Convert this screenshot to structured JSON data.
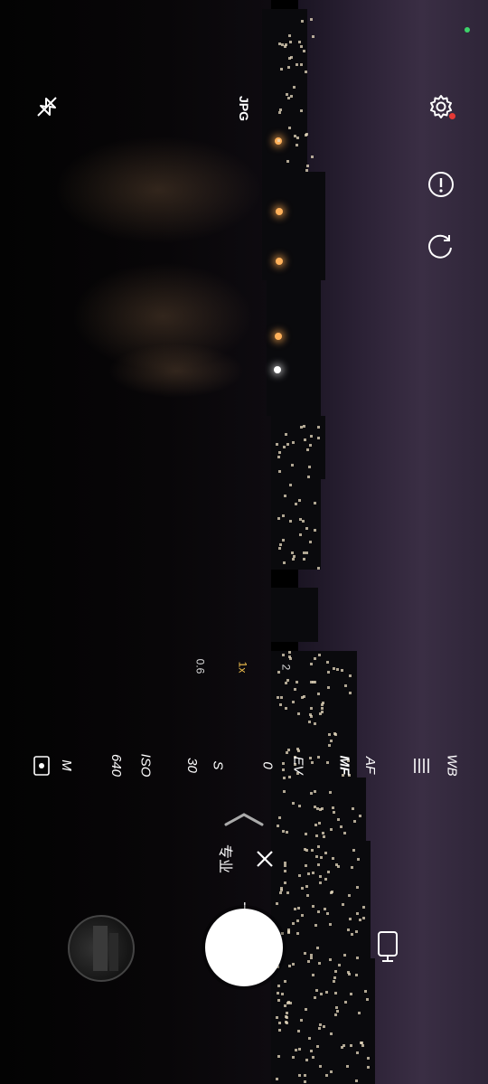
{
  "status": {
    "indicator_color": "#3dd36a"
  },
  "top_controls": {
    "flash_icon": "flash-off-icon",
    "format_label": "JPG",
    "settings_icon": "gear-icon",
    "settings_badge_color": "#e53935",
    "info_icon": "info-icon",
    "rotate_icon": "rotate-icon"
  },
  "zoom": {
    "options": [
      "0.6",
      "1x",
      "2"
    ],
    "selected": "1x"
  },
  "pro_params": [
    {
      "label": "M",
      "icon": "metering-icon"
    },
    {
      "label": "640"
    },
    {
      "label": "ISO"
    },
    {
      "label": "30"
    },
    {
      "label": "S"
    },
    {
      "label": "0"
    },
    {
      "label": "EV"
    },
    {
      "label": "MF"
    },
    {
      "label": "AF"
    },
    {
      "label": "WB"
    }
  ],
  "mode": {
    "label": "专业",
    "close_icon": "close-icon",
    "expand_icon": "chevron-icon"
  },
  "bottom": {
    "gallery_icon": "gallery-thumbnail",
    "shutter_icon": "shutter-button",
    "switch_camera_icon": "camera-switch-icon"
  },
  "colors": {
    "accent": "#f2c14e"
  }
}
